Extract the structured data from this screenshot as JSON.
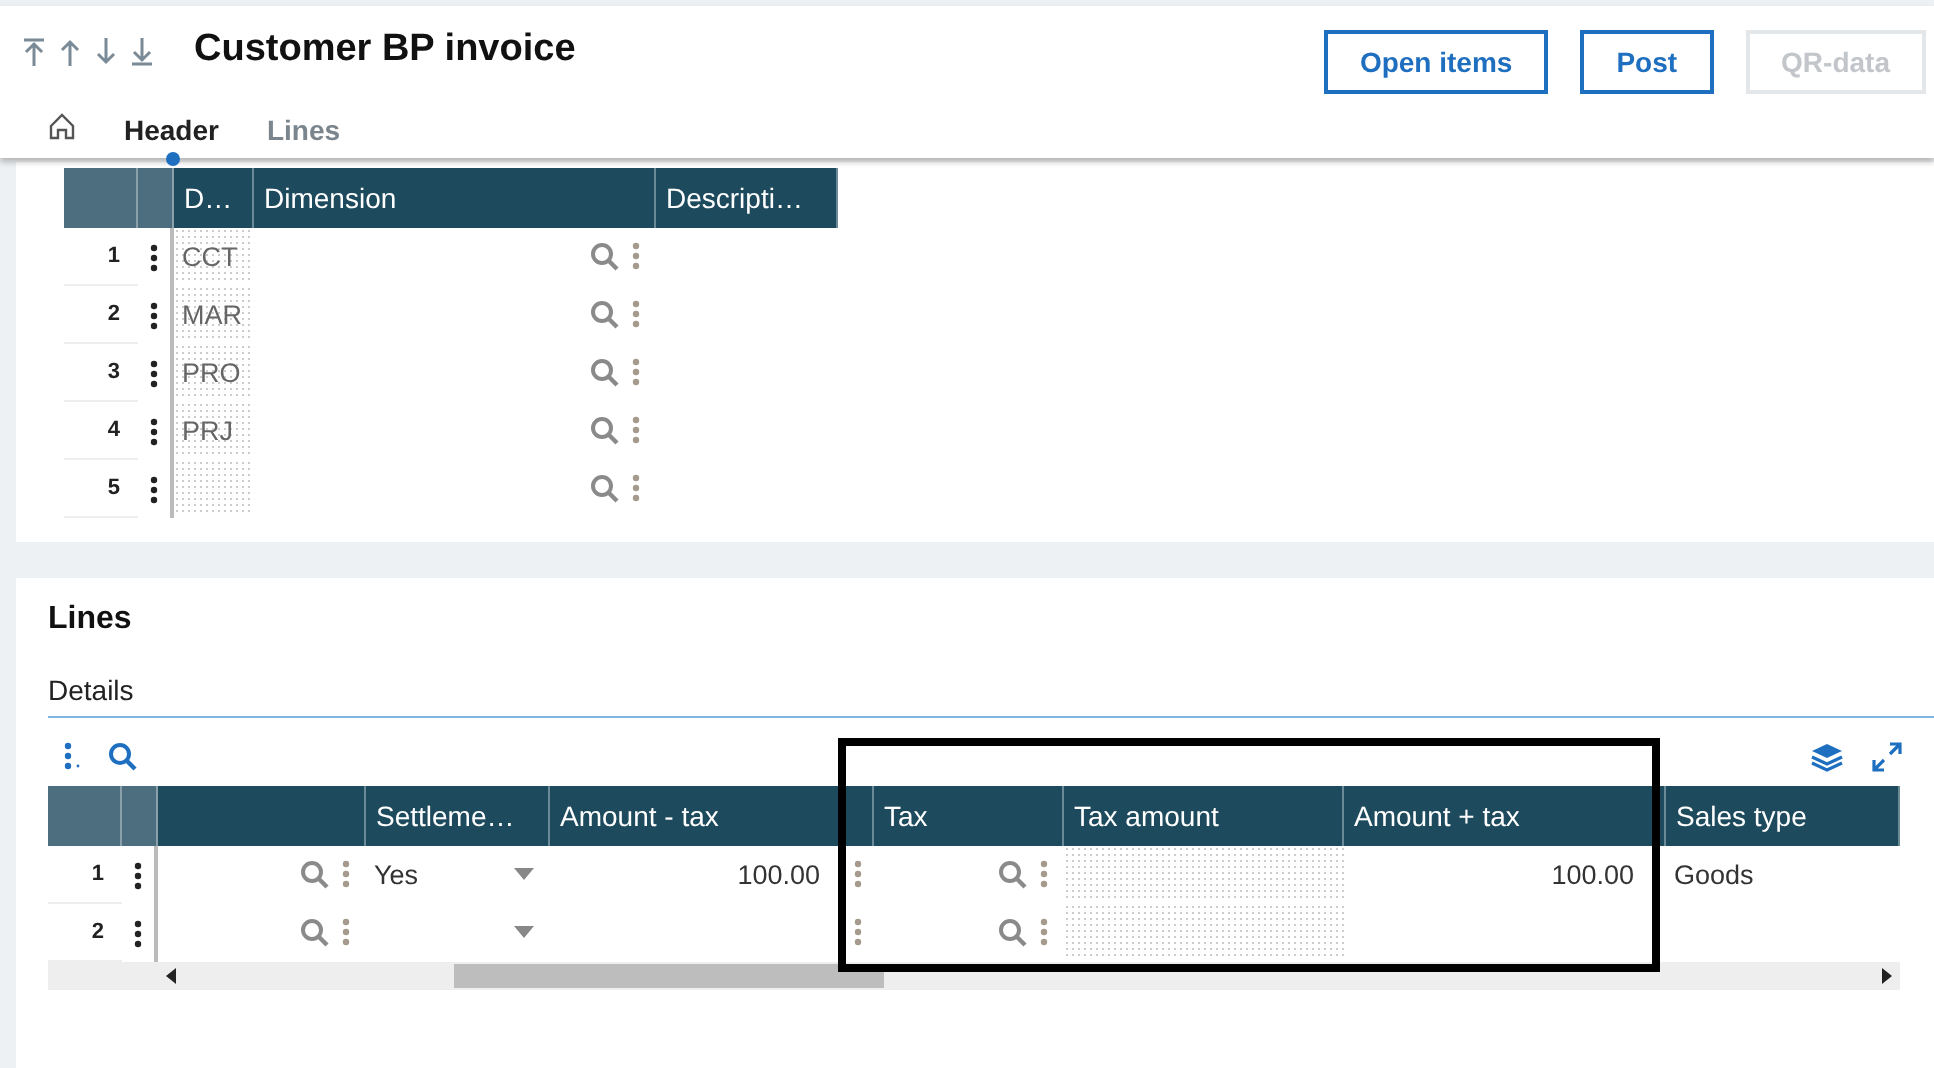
{
  "title": "Customer BP invoice",
  "tabs": [
    {
      "label": "Header",
      "selected": true
    },
    {
      "label": "Lines",
      "selected": false
    }
  ],
  "buttons": [
    {
      "label": "Open items",
      "disabled": false
    },
    {
      "label": "Post",
      "disabled": false
    },
    {
      "label": "QR-data",
      "disabled": true
    }
  ],
  "dimensions_table": {
    "columns": [
      "D…",
      "Dimension",
      "Descripti…"
    ],
    "rows": [
      {
        "num": "1",
        "code": "CCT"
      },
      {
        "num": "2",
        "code": "MAR"
      },
      {
        "num": "3",
        "code": "PRO"
      },
      {
        "num": "4",
        "code": "PRJ"
      },
      {
        "num": "5"
      }
    ]
  },
  "lines_section": {
    "title": "Lines",
    "subtitle": "Details",
    "columns": [
      "Settleme…",
      "Amount - tax",
      "Tax",
      "Tax amount",
      "Amount + tax",
      "Sales type"
    ],
    "rows": [
      {
        "num": "1",
        "settlement": "Yes",
        "amount_tax": "100.00",
        "amount_plus_tax": "100.00",
        "sales_type": "Goods"
      },
      {
        "num": "2"
      }
    ]
  }
}
